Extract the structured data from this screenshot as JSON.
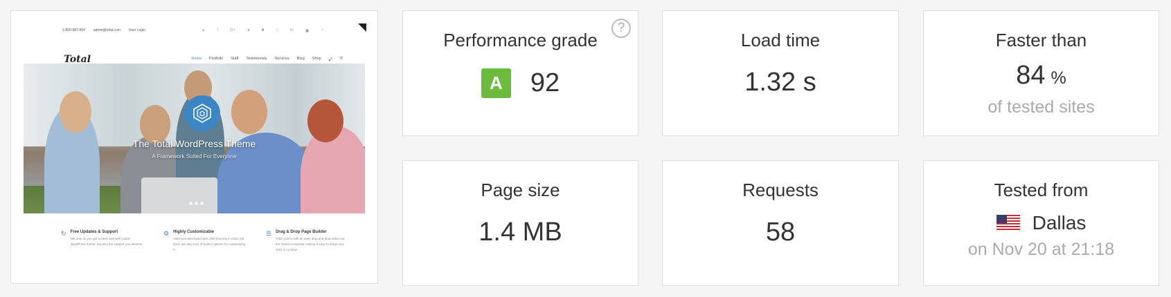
{
  "screenshot": {
    "topbar": {
      "phone": "1-800-987-654",
      "email": "admin@total.com",
      "login": "User Login"
    },
    "logo": "Total",
    "menu": [
      "Home",
      "Portfolio",
      "Staff",
      "Testimonials",
      "Services",
      "Blog",
      "Shop"
    ],
    "cart_count": "0",
    "hero_title": "The Total WordPress Theme",
    "hero_subtitle": "A Framework Suited For Everyone",
    "features": [
      {
        "title": "Free Updates & Support",
        "desc": "Not only do you get a clean and well coded WordPress theme, but also the support you deserve."
      },
      {
        "title": "Highly Customizable",
        "desc": "Total was developed with child theming in mind, but there are also tons of built-in options for customizing it."
      },
      {
        "title": "Drag & Drop Page Builder",
        "desc": "Total comes with an easy drag and drop editor via the Visual Composer making it easy to setup new sites in no time!"
      }
    ]
  },
  "metrics": {
    "performance": {
      "label": "Performance grade",
      "grade": "A",
      "score": "92",
      "help": "?"
    },
    "load_time": {
      "label": "Load time",
      "value": "1.32 s"
    },
    "faster": {
      "label": "Faster than",
      "value": "84",
      "unit": "%",
      "sub": "of tested sites"
    },
    "page_size": {
      "label": "Page size",
      "value": "1.4 MB"
    },
    "requests": {
      "label": "Requests",
      "value": "58"
    },
    "tested_from": {
      "label": "Tested from",
      "location": "Dallas",
      "date": "on Nov 20 at 21:18"
    }
  },
  "colors": {
    "grade_green": "#6cbb3c",
    "accent_blue": "#3d86c6"
  }
}
